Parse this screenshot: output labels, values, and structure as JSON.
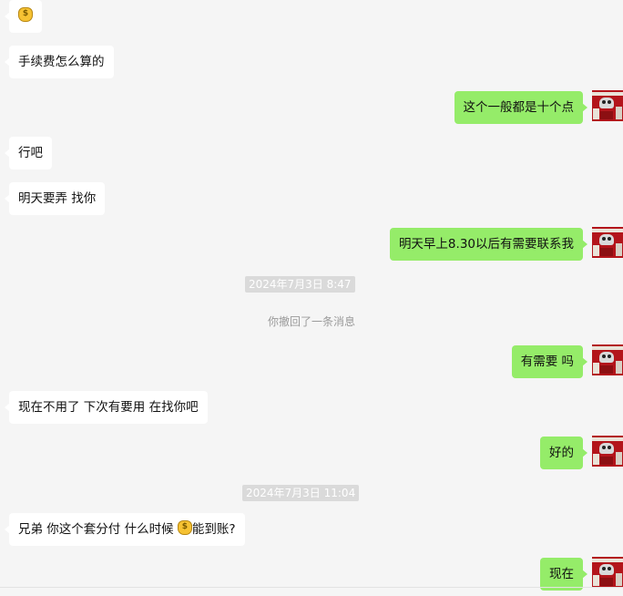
{
  "messages": [
    {
      "text": "",
      "icon": "money-bag"
    },
    {
      "text": "手续费怎么算的"
    },
    {
      "text": "这个一般都是十个点"
    },
    {
      "text": "行吧"
    },
    {
      "text": "明天要弄 找你"
    },
    {
      "text": "明天早上8.30以后有需要联系我"
    },
    {
      "text": "有需要 吗"
    },
    {
      "text": "现在不用了 下次有要用 在找你吧"
    },
    {
      "text": "好的"
    },
    {
      "text_before": "兄弟 你这个套分付 什么时候 ",
      "text_after": "能到账?",
      "icon": "money-bag"
    },
    {
      "text": "现在"
    }
  ],
  "timestamps": [
    "2024年7月3日 8:47",
    "2024年7月3日 11:04"
  ],
  "system": {
    "recalled": "你撤回了一条消息"
  },
  "avatar": {
    "icon": "user-avatar-icon",
    "color": "#b3151b"
  },
  "colors": {
    "outgoing_bubble": "#95ec69",
    "incoming_bubble": "#ffffff",
    "background": "#f5f5f5"
  }
}
